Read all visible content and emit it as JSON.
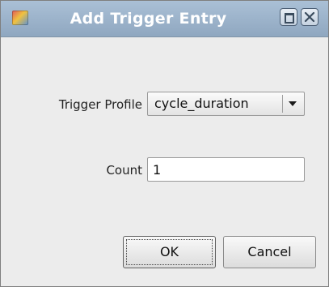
{
  "window": {
    "title": "Add Trigger Entry"
  },
  "form": {
    "trigger_profile": {
      "label": "Trigger Profile",
      "selected": "cycle_duration"
    },
    "count": {
      "label": "Count",
      "value": "1"
    }
  },
  "buttons": {
    "ok": "OK",
    "cancel": "Cancel"
  },
  "icons": {
    "app": "app-icon",
    "maximize": "maximize-icon",
    "close": "close-icon",
    "dropdown": "chevron-down-icon"
  }
}
